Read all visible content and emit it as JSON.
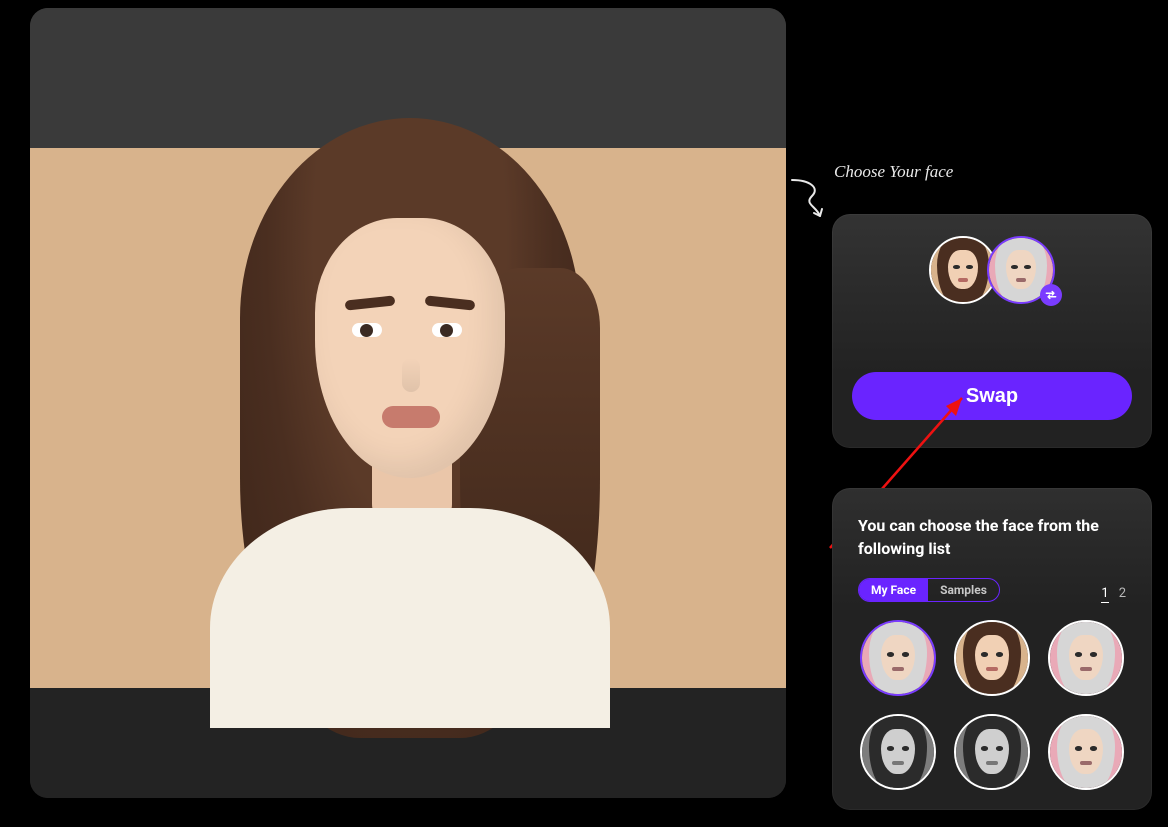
{
  "hint": {
    "text": "Choose Your face"
  },
  "swap": {
    "button_label": "Swap"
  },
  "facePanel": {
    "title": "You can choose the face from the following list",
    "tabs": {
      "my_face": "My Face",
      "samples": "Samples",
      "active": "my_face"
    },
    "pager": {
      "current": "1",
      "total": "2"
    }
  },
  "sourceFace": {
    "desc": "young-woman-brown-hair"
  },
  "targetFace": {
    "desc": "older-woman-grey-hair"
  },
  "faceList": [
    {
      "id": "face-1",
      "desc": "older-woman-grey-hair-pink-bg",
      "selected": true
    },
    {
      "id": "face-2",
      "desc": "young-woman-brown-hair-tan-bg",
      "selected": false
    },
    {
      "id": "face-3",
      "desc": "older-woman-pink-bg-alt",
      "selected": false
    },
    {
      "id": "face-4",
      "desc": "person-grayscale-1",
      "selected": false
    },
    {
      "id": "face-5",
      "desc": "person-grayscale-2",
      "selected": false
    },
    {
      "id": "face-6",
      "desc": "older-woman-pink-bg-2",
      "selected": false
    }
  ],
  "colors": {
    "accent": "#6a24ff",
    "accent_border": "#7a3cff"
  }
}
